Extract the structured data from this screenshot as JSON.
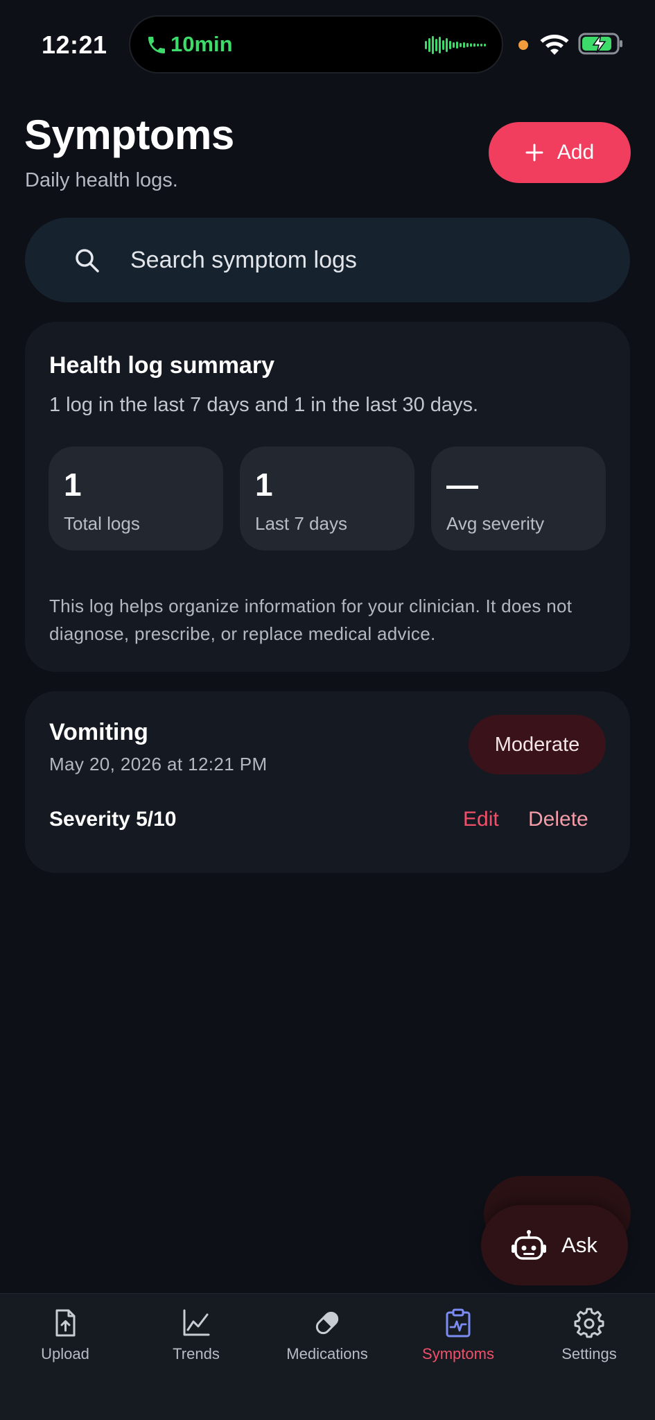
{
  "status_bar": {
    "time": "12:21",
    "call_duration": "10min"
  },
  "header": {
    "title": "Symptoms",
    "subtitle": "Daily health logs.",
    "add_label": "Add"
  },
  "search": {
    "placeholder": "Search symptom logs"
  },
  "summary": {
    "title": "Health log summary",
    "text": "1 log in the last 7 days and 1 in the last 30 days.",
    "stats": [
      {
        "value": "1",
        "label": "Total logs"
      },
      {
        "value": "1",
        "label": "Last 7 days"
      },
      {
        "value": "—",
        "label": "Avg severity"
      }
    ],
    "disclaimer": "This log helps organize information for your clinician. It does not diagnose, prescribe, or replace medical advice."
  },
  "logs": [
    {
      "title": "Vomiting",
      "date": "May 20, 2026 at 12:21 PM",
      "badge": "Moderate",
      "severity": "Severity 5/10",
      "edit_label": "Edit",
      "delete_label": "Delete"
    }
  ],
  "ask": {
    "label": "Ask"
  },
  "nav": {
    "items": [
      {
        "label": "Upload",
        "icon": "upload-icon"
      },
      {
        "label": "Trends",
        "icon": "trends-icon"
      },
      {
        "label": "Medications",
        "icon": "pill-icon"
      },
      {
        "label": "Symptoms",
        "icon": "clipboard-pulse-icon",
        "active": true
      },
      {
        "label": "Settings",
        "icon": "gear-icon"
      }
    ]
  },
  "colors": {
    "background": "#0d1017",
    "accent": "#f23e5e",
    "card": "#151a22",
    "active_icon": "#7b8df2",
    "call_green": "#3ddc6a"
  }
}
